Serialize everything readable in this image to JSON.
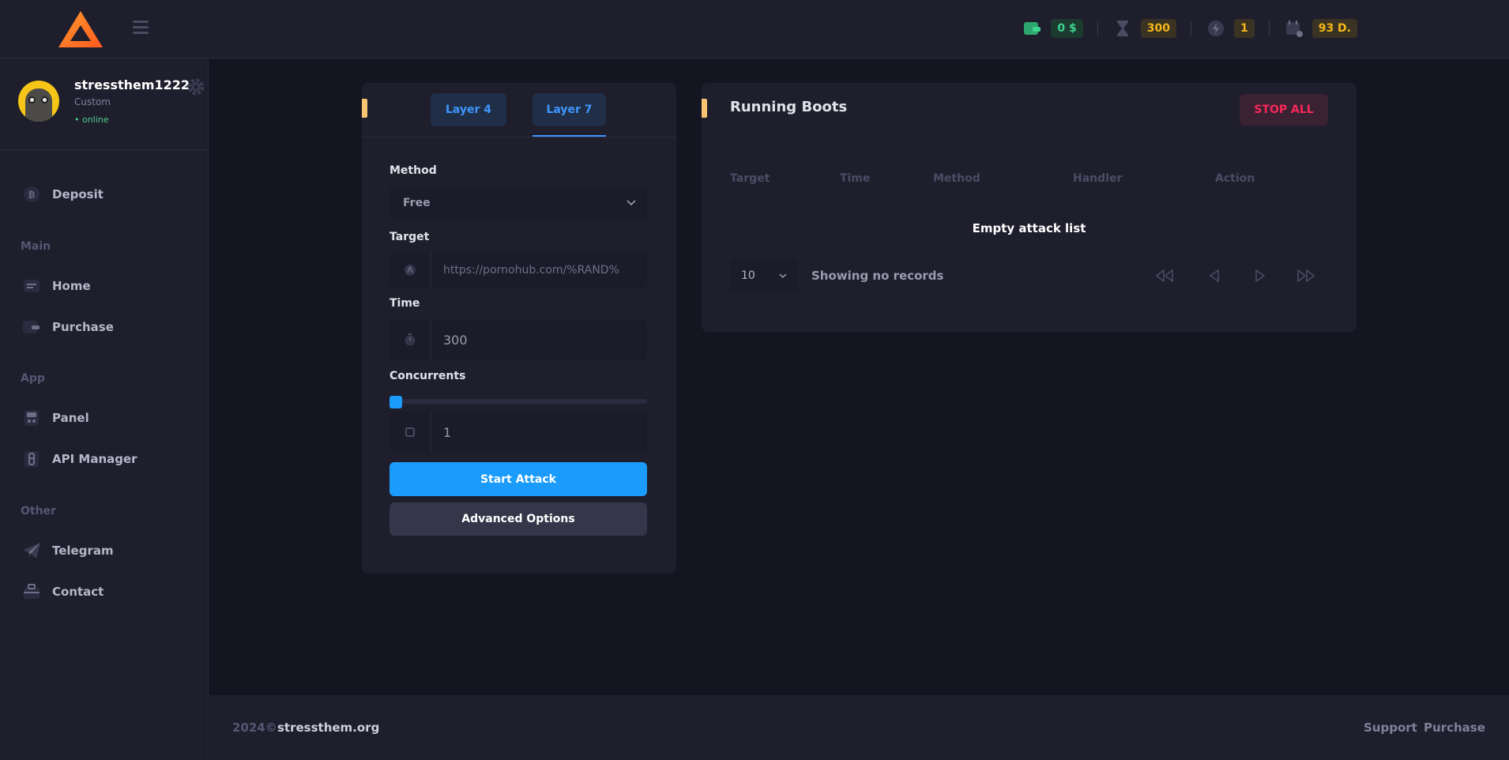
{
  "header": {
    "logo": "triangle-logo",
    "stats": [
      {
        "icon": "wallet-icon",
        "value": "0 $",
        "color": "green"
      },
      {
        "icon": "hourglass-icon",
        "value": "300",
        "color": "yellow"
      },
      {
        "icon": "bolt-icon",
        "value": "1",
        "color": "yellow"
      },
      {
        "icon": "calendar-icon",
        "value": "93 D.",
        "color": "yellow"
      }
    ]
  },
  "sidebar": {
    "username": "stressthem1222",
    "role": "Custom",
    "status": "• online",
    "sections": {
      "main": "Main",
      "app": "App",
      "other": "Other"
    },
    "items": {
      "deposit": "Deposit",
      "home": "Home",
      "purchase": "Purchase",
      "panel": "Panel",
      "api": "API Manager",
      "telegram": "Telegram",
      "contact": "Contact"
    }
  },
  "attack": {
    "tabs": [
      "Layer 4",
      "Layer 7"
    ],
    "active_tab": "Layer 7",
    "method_label": "Method",
    "method_value": "Free",
    "target_label": "Target",
    "target_placeholder": "https://pornohub.com/%RAND%",
    "time_label": "Time",
    "time_value": "300",
    "concurrents_label": "Concurrents",
    "concurrents_value": "1",
    "concurrents_slider_fraction": 0,
    "start_button": "Start Attack",
    "advanced_button": "Advanced Options"
  },
  "running": {
    "title": "Running Boots",
    "stop_button": "STOP ALL",
    "columns": [
      "Target",
      "Time",
      "Method",
      "Handler",
      "Action"
    ],
    "empty_message": "Empty attack list",
    "page_size": "10",
    "showing": "Showing no records"
  },
  "footer": {
    "year": "2024©",
    "site": "stressthem.org",
    "links": [
      "Support",
      "Purchase"
    ]
  },
  "colors": {
    "background": "#151521",
    "panel": "#1e1e2d",
    "primary": "#1b9cfc",
    "danger": "#f8285a",
    "accent": "#f8c471",
    "success": "#50cd89",
    "warning": "#f5b819"
  }
}
